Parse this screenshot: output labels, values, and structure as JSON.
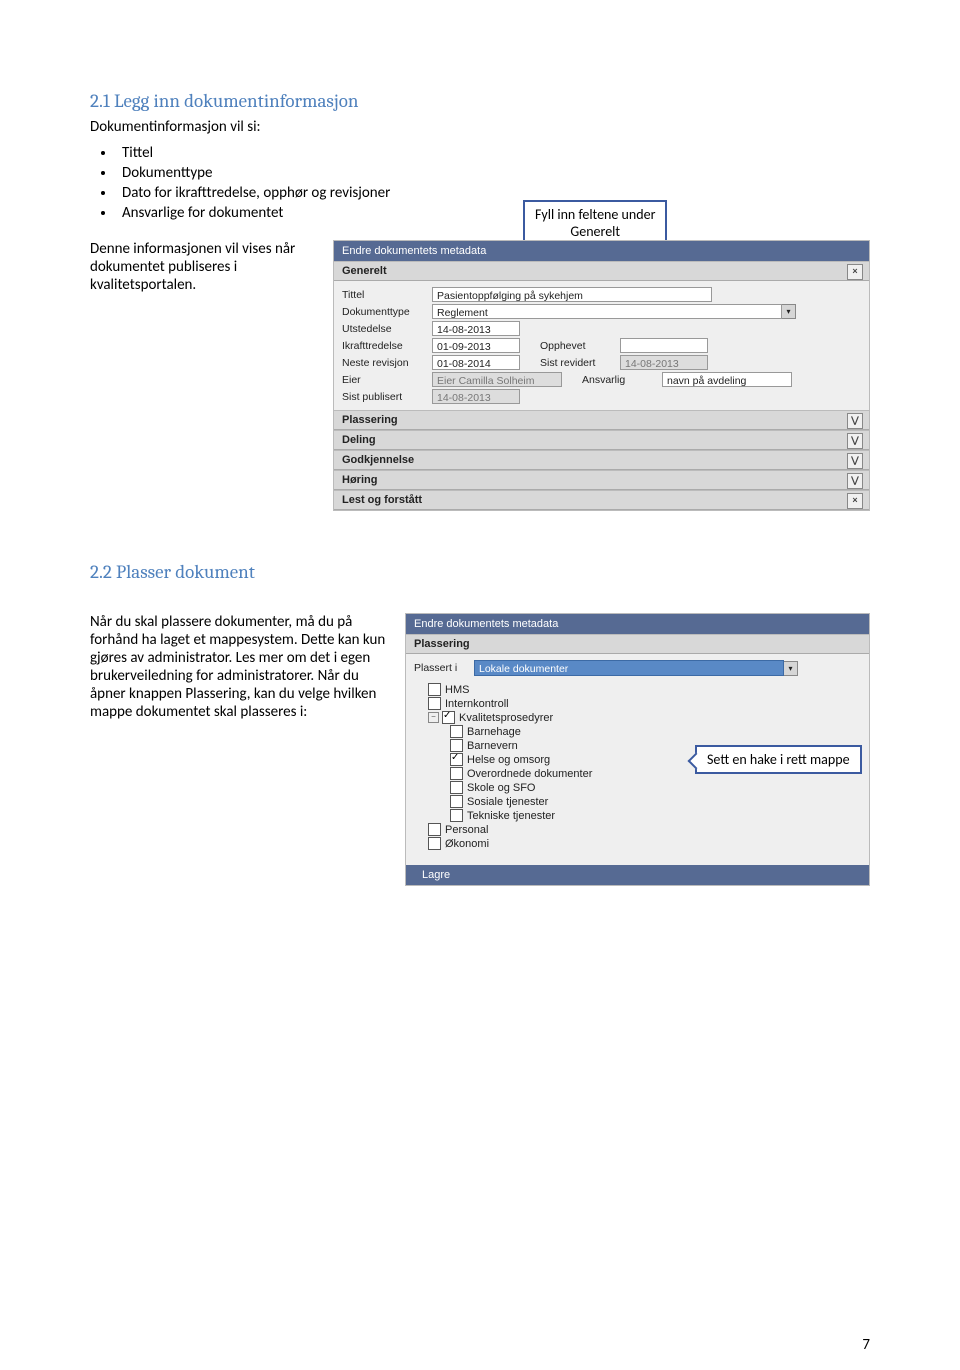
{
  "section1": {
    "heading": "2.1 Legg inn dokumentinformasjon",
    "intro": "Dokumentinformasjon vil si:",
    "bullets": [
      "Tittel",
      "Dokumenttype",
      "Dato for ikrafttredelse, opphør og revisjoner",
      "Ansvarlige for dokumentet"
    ],
    "paragraph": "Denne informasjonen vil vises når dokumentet publiseres i kvalitetsportalen."
  },
  "screenshot1": {
    "callout_line1": "Fyll inn feltene under",
    "callout_line2": "Generelt",
    "dialog_title": "Endre dokumentets metadata",
    "sections": {
      "generelt": "Generelt",
      "plassering": "Plassering",
      "deling": "Deling",
      "godkjennelse": "Godkjennelse",
      "horing": "Høring",
      "lest": "Lest og forstått"
    },
    "labels": {
      "tittel": "Tittel",
      "dokumenttype": "Dokumenttype",
      "utstedelse": "Utstedelse",
      "ikrafttredelse": "Ikrafttredelse",
      "neste_revisjon": "Neste revisjon",
      "eier": "Eier",
      "sist_publisert": "Sist publisert",
      "opphevet": "Opphevet",
      "sist_revidert": "Sist revidert",
      "ansvarlig": "Ansvarlig"
    },
    "values": {
      "tittel": "Pasientoppfølging på sykehjem",
      "dokumenttype": "Reglement",
      "utstedelse": "14-08-2013",
      "ikrafttredelse": "01-09-2013",
      "neste_revisjon": "01-08-2014",
      "eier": "Eier Camilla Solheim",
      "sist_publisert": "14-08-2013",
      "opphevet": "",
      "sist_revidert": "14-08-2013",
      "ansvarlig": "navn på avdeling"
    }
  },
  "section2": {
    "heading": "2.2 Plasser dokument",
    "paragraph": "Når du skal plassere dokumenter, må du på forhånd ha laget et mappesystem. Dette kan kun gjøres av administrator. Les mer om det i egen brukerveiledning for administratorer. Når du åpner knappen Plassering, kan du velge hvilken mappe dokumentet skal plasseres i:"
  },
  "screenshot2": {
    "dialog_title": "Endre dokumentets metadata",
    "section_plassering": "Plassering",
    "plassert_i": "Plassert i",
    "dropdown_value": "Lokale dokumenter",
    "callout": "Sett en hake i rett mappe",
    "tree": [
      {
        "label": "HMS",
        "checked": false,
        "depth": 0
      },
      {
        "label": "Internkontroll",
        "checked": false,
        "depth": 0
      },
      {
        "label": "Kvalitetsprosedyrer",
        "checked": true,
        "depth": 0,
        "expanded": true
      },
      {
        "label": "Barnehage",
        "checked": false,
        "depth": 1
      },
      {
        "label": "Barnevern",
        "checked": false,
        "depth": 1
      },
      {
        "label": "Helse og omsorg",
        "checked": true,
        "depth": 1
      },
      {
        "label": "Overordnede dokumenter",
        "checked": false,
        "depth": 1
      },
      {
        "label": "Skole og SFO",
        "checked": false,
        "depth": 1
      },
      {
        "label": "Sosiale tjenester",
        "checked": false,
        "depth": 1
      },
      {
        "label": "Tekniske tjenester",
        "checked": false,
        "depth": 1
      },
      {
        "label": "Personal",
        "checked": false,
        "depth": 0
      },
      {
        "label": "Økonomi",
        "checked": false,
        "depth": 0
      }
    ],
    "save_button": "Lagre"
  },
  "page_number": "7"
}
